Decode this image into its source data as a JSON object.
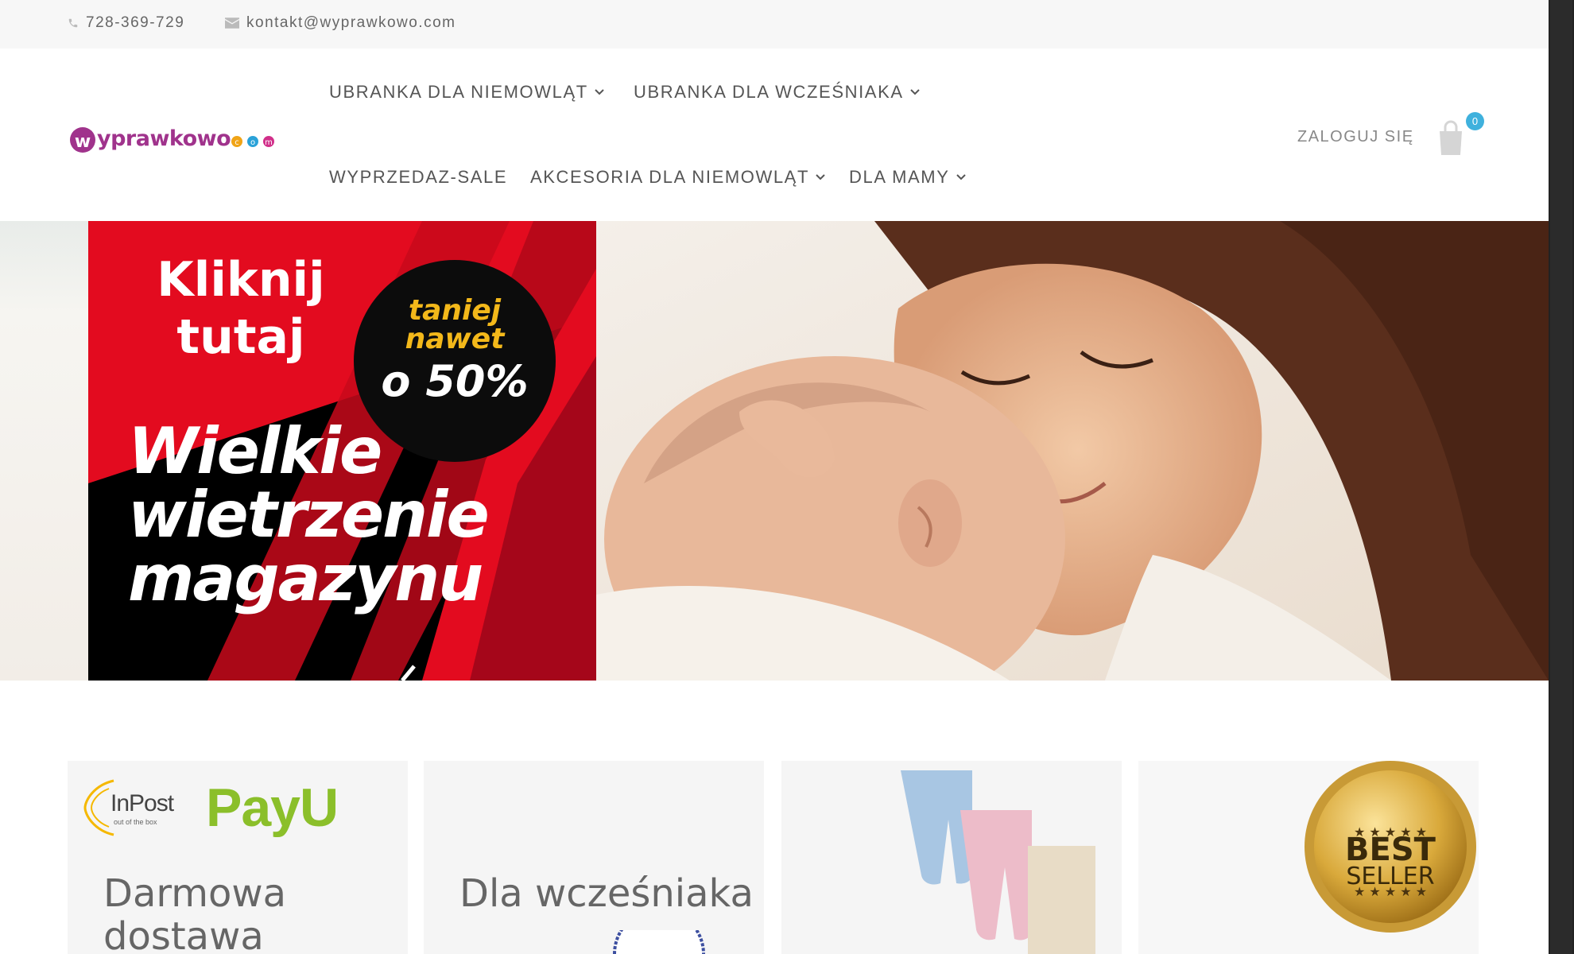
{
  "topbar": {
    "phone": "728-369-729",
    "email": "kontakt@wyprawkowo.com",
    "phone_icon": "phone-icon",
    "email_icon": "envelope-icon"
  },
  "header": {
    "logo_text": "wyprawkowo",
    "logo_suffix": "com",
    "nav": [
      {
        "label": "UBRANKA DLA NIEMOWLĄT",
        "has_dropdown": true
      },
      {
        "label": "UBRANKA DLA WCZEŚNIAKA",
        "has_dropdown": true
      },
      {
        "label": "WYPRZEDAZ-SALE",
        "has_dropdown": false
      },
      {
        "label": "AKCESORIA DLA NIEMOWLĄT",
        "has_dropdown": true
      },
      {
        "label": "DLA MAMY",
        "has_dropdown": true
      }
    ],
    "login": "ZALOGUJ SIĘ",
    "cart_count": "0",
    "cart_icon": "shopping-bag-icon"
  },
  "hero": {
    "promo": {
      "line1": "Kliknij",
      "line2": "tutaj",
      "badge_line1": "taniej",
      "badge_line2": "nawet",
      "badge_line3": "o 50%",
      "main_line1": "Wielkie",
      "main_line2": "wietrzenie",
      "main_line3": "magazynu"
    }
  },
  "cards": [
    {
      "title_line1": "Darmowa",
      "title_line2": "dostawa",
      "logos": [
        "InPost",
        "PayU"
      ],
      "inpost_tagline": "out of the box"
    },
    {
      "title_line1": "Dla wcześniaka",
      "title_line2": ""
    },
    {
      "title_line1": "",
      "title_line2": ""
    },
    {
      "title_line1": "",
      "title_line2": "",
      "badge_line1": "BEST",
      "badge_line2": "SELLER"
    }
  ],
  "colors": {
    "accent_red": "#e30b1f",
    "badge_yellow": "#f3b81a",
    "cart_badge": "#3fb1dd",
    "payu_green": "#8bbf2a"
  }
}
